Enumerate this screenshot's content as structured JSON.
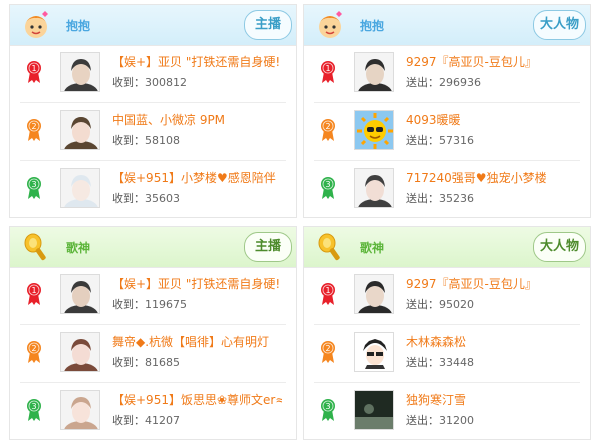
{
  "panels": [
    {
      "title": "抱抱",
      "badge": "主播",
      "stat_label": "收到：",
      "rows": [
        {
          "rank": "1",
          "name": "【娱+】亚贝 \"打铁还需自身硬!",
          "value": "300812"
        },
        {
          "rank": "2",
          "name": "中国蓝、小微凉 9PM",
          "value": "58108"
        },
        {
          "rank": "3",
          "name": "【娱+951】小梦楼♥感恩陪伴",
          "value": "35603"
        }
      ]
    },
    {
      "title": "抱抱",
      "badge": "大人物",
      "stat_label": "送出：",
      "rows": [
        {
          "rank": "1",
          "name": "9297『高亚贝-豆包儿』",
          "value": "296936"
        },
        {
          "rank": "2",
          "name": "4093暖暖",
          "value": "57316"
        },
        {
          "rank": "3",
          "name": "717240强哥♥独宠小梦楼",
          "value": "35236"
        }
      ]
    },
    {
      "title": "歌神",
      "badge": "主播",
      "stat_label": "收到：",
      "rows": [
        {
          "rank": "1",
          "name": "【娱+】亚贝 \"打铁还需自身硬!",
          "value": "119675"
        },
        {
          "rank": "2",
          "name": "舞帝◆.杭微【唱徘】心有明灯",
          "value": "81685"
        },
        {
          "rank": "3",
          "name": "【娱+951】饭思思❀尊师文er≈",
          "value": "41207"
        }
      ]
    },
    {
      "title": "歌神",
      "badge": "大人物",
      "stat_label": "送出：",
      "rows": [
        {
          "rank": "1",
          "name": "9297『高亚贝-豆包儿』",
          "value": "95020"
        },
        {
          "rank": "2",
          "name": "木林森森松",
          "value": "33448"
        },
        {
          "rank": "3",
          "name": "独狗寒汀雪",
          "value": "31200"
        }
      ]
    }
  ],
  "colors": {
    "rank1": "#e8202a",
    "rank2": "#f5861f",
    "rank3": "#2fb24b",
    "name": "#f07a18"
  }
}
